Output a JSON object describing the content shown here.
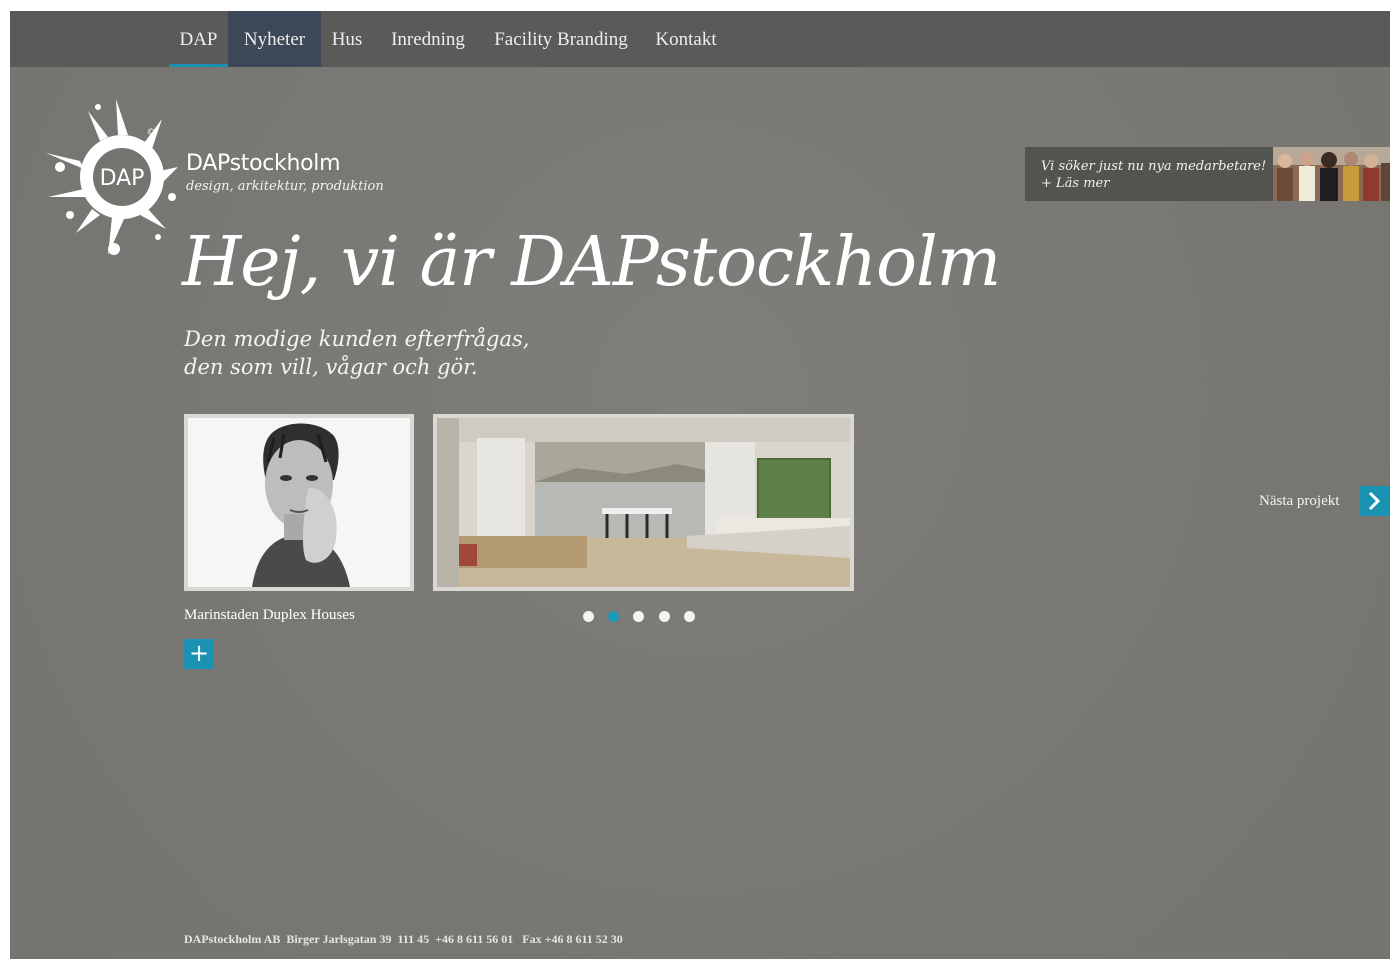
{
  "nav": {
    "items": [
      {
        "label": "DAP"
      },
      {
        "label": "Nyheter"
      },
      {
        "label": "Hus"
      },
      {
        "label": "Inredning"
      },
      {
        "label": "Facility Branding"
      },
      {
        "label": "Kontakt"
      }
    ],
    "active_underline": "DAP",
    "highlighted": "Nyheter"
  },
  "brand": {
    "logo_text": "DAP",
    "copyright_mark": "©",
    "name": "DAPstockholm",
    "tagline": "design, arkitektur, produktion"
  },
  "recruit": {
    "line1": "Vi söker just nu nya medarbetare!",
    "line2": "+ Läs mer"
  },
  "hero": {
    "headline": "Hej, vi är DAPstockholm",
    "subline1": "Den modige kunden efterfrågas,",
    "subline2": "den som vill, vågar och gör."
  },
  "project": {
    "title": "Marinstaden Duplex Houses",
    "plus_label": "+",
    "next_label": "Nästa projekt"
  },
  "slider": {
    "count": 5,
    "active_index": 1
  },
  "footer": {
    "text": "DAPstockholm AB  Birger Jarlsgatan 39  111 45  +46 8 611 56 01   Fax +46 8 611 52 30"
  },
  "colors": {
    "accent": "#1a93b3",
    "nav_bg": "#5a5a58",
    "nav_highlight": "#3c4757",
    "page_bg": "#7b7a76"
  }
}
